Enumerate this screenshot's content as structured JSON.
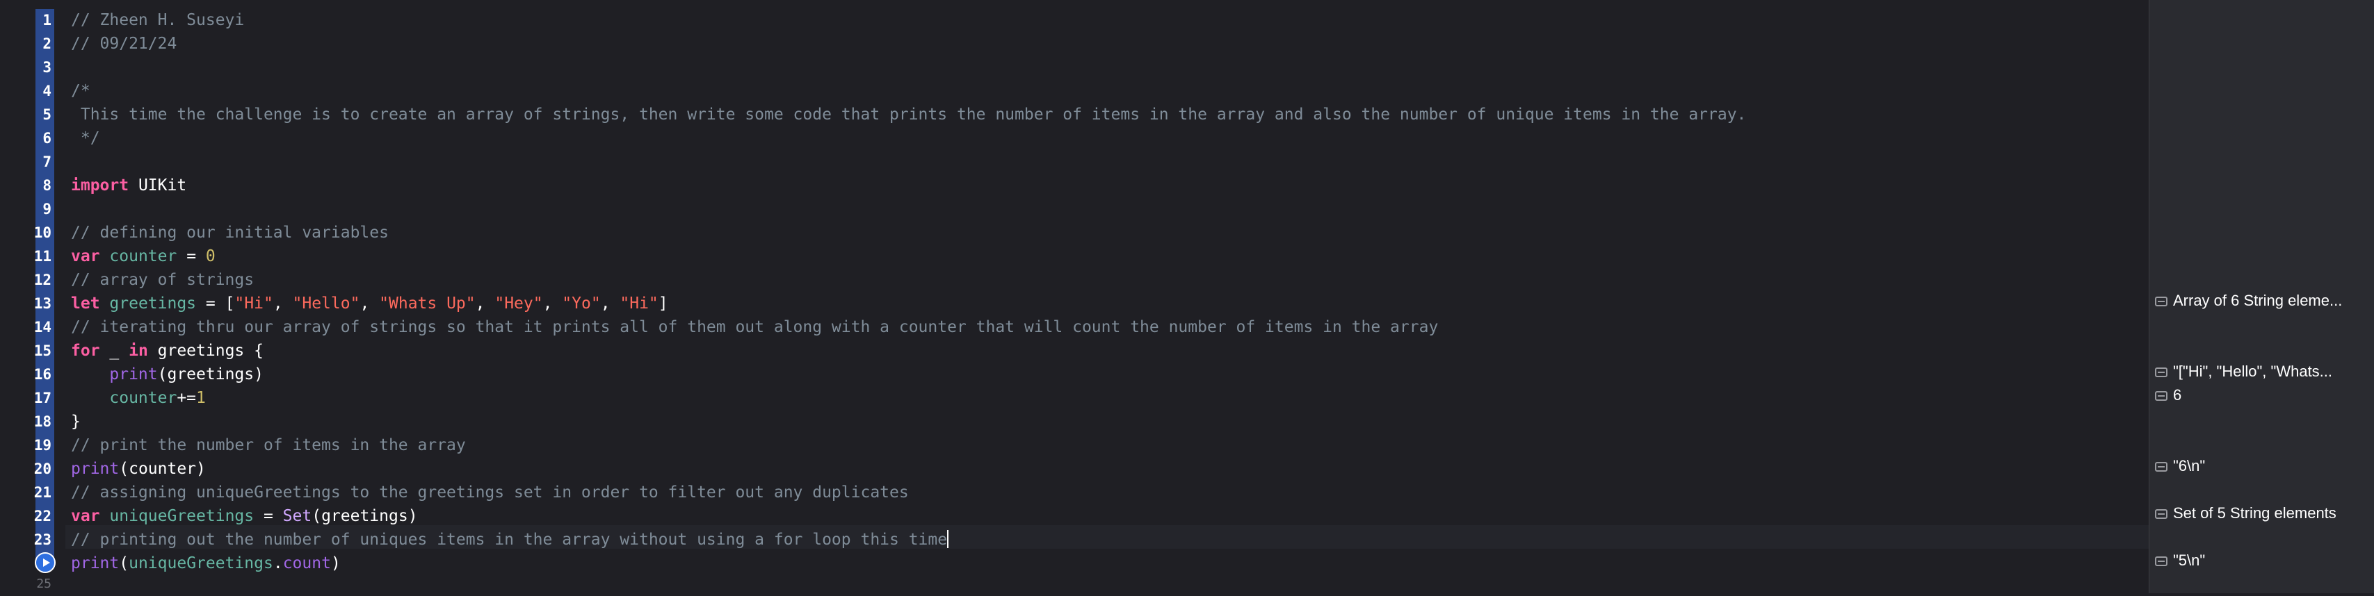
{
  "editor": {
    "line_numbers": [
      "1",
      "2",
      "3",
      "4",
      "5",
      "6",
      "7",
      "8",
      "9",
      "10",
      "11",
      "12",
      "13",
      "14",
      "15",
      "16",
      "17",
      "18",
      "19",
      "20",
      "21",
      "22",
      "23",
      "24",
      "25"
    ],
    "lines": {
      "l1": "// Zheen H. Suseyi",
      "l2": "// 09/21/24",
      "l4": "/*",
      "l5": " This time the challenge is to create an array of strings, then write some code that prints the number of items in the array and also the number of unique items in the array.",
      "l6": " */",
      "l8_kw": "import",
      "l8_rest": " UIKit",
      "l10": "// defining our initial variables",
      "l11_kw": "var",
      "l11_name": "counter",
      "l11_eq": " = ",
      "l11_num": "0",
      "l12": "// array of strings",
      "l13_kw": "let",
      "l13_name": "greetings",
      "l13_eq": " = [",
      "l13_s1": "\"Hi\"",
      "l13_s2": "\"Hello\"",
      "l13_s3": "\"Whats Up\"",
      "l13_s4": "\"Hey\"",
      "l13_s5": "\"Yo\"",
      "l13_s6": "\"Hi\"",
      "l13_sep": ", ",
      "l13_close": "]",
      "l14": "// iterating thru our array of strings so that it prints all of them out along with a counter that will count the number of items in the array",
      "l15_kw1": "for",
      "l15_mid": " _ ",
      "l15_kw2": "in",
      "l15_rest": " greetings {",
      "l16_indent": "    ",
      "l16_fn": "print",
      "l16_rest": "(greetings)",
      "l17_indent": "    ",
      "l17_name": "counter",
      "l17_op": "+=",
      "l17_num": "1",
      "l18": "}",
      "l19": "// print the number of items in the array",
      "l20_fn": "print",
      "l20_rest": "(counter)",
      "l21": "// assigning uniqueGreetings to the greetings set in order to filter out any duplicates",
      "l22_kw": "var",
      "l22_name": "uniqueGreetings",
      "l22_eq": " = ",
      "l22_type": "Set",
      "l22_rest": "(greetings)",
      "l23": "// printing out the number of uniques items in the array without using a for loop this time",
      "l24_fn": "print",
      "l24_p1": "(",
      "l24_name": "uniqueGreetings",
      "l24_dot": ".",
      "l24_prop": "count",
      "l24_p2": ")"
    }
  },
  "results": {
    "r13": "Array of 6 String eleme...",
    "r16": "\"[\"Hi\", \"Hello\", \"Whats...",
    "r17": "6",
    "r20": "\"6\\n\"",
    "r22": "Set of 5 String elements",
    "r24": "\"5\\n\""
  },
  "colors": {
    "background": "#1f1f24",
    "comment": "#7f8c98",
    "keyword": "#fc5fa3",
    "string": "#fc6a5d",
    "number": "#d0bf69",
    "function": "#a167e6",
    "variable": "#67b7a4",
    "gutter_highlight": "#2b4a8f",
    "run_button": "#2e6fe0"
  },
  "icons": {
    "run": "play-circle-icon",
    "result": "quicklook-icon"
  }
}
